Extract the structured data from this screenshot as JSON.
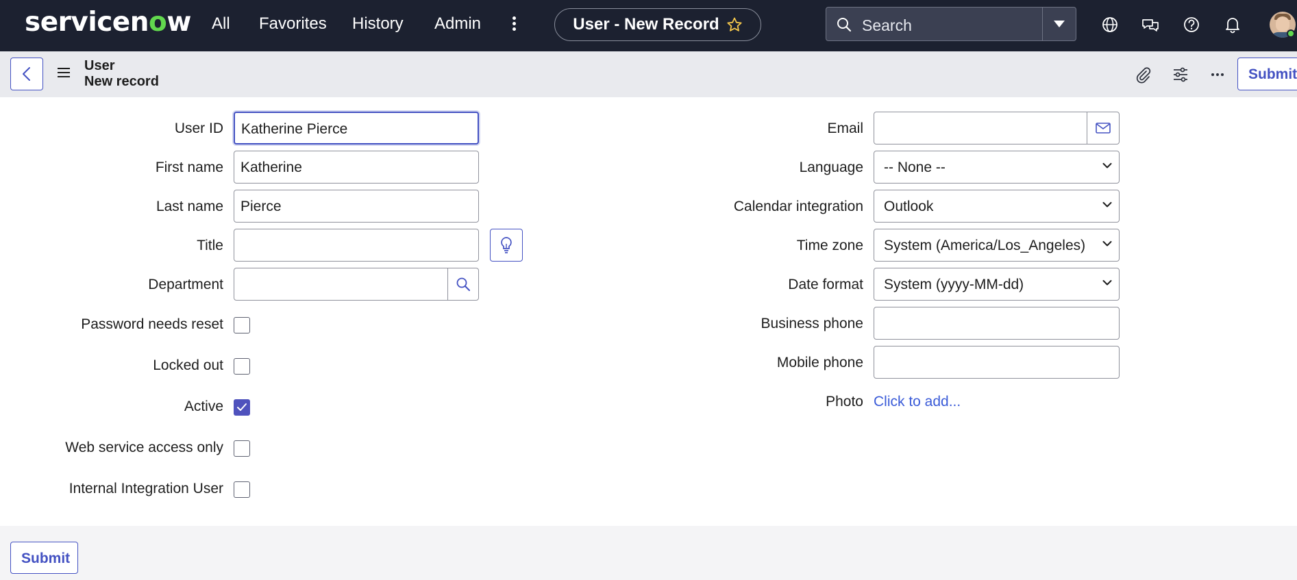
{
  "topnav": {
    "logo_text_a": "servicen",
    "logo_text_o": "o",
    "logo_text_b": "w",
    "links": [
      "All",
      "Favorites",
      "History",
      "Admin"
    ],
    "record_title": "User - New Record",
    "search_placeholder": "Search"
  },
  "header": {
    "table_name": "User",
    "record_state": "New record",
    "submit_label": "Submit"
  },
  "form": {
    "left": {
      "user_id": {
        "label": "User ID",
        "value": "Katherine Pierce"
      },
      "first_name": {
        "label": "First name",
        "value": "Katherine"
      },
      "last_name": {
        "label": "Last name",
        "value": "Pierce"
      },
      "title": {
        "label": "Title",
        "value": ""
      },
      "department": {
        "label": "Department",
        "value": ""
      },
      "password_needs_reset": {
        "label": "Password needs reset",
        "checked": false
      },
      "locked_out": {
        "label": "Locked out",
        "checked": false
      },
      "active": {
        "label": "Active",
        "checked": true
      },
      "web_service_access_only": {
        "label": "Web service access only",
        "checked": false
      },
      "internal_integration_user": {
        "label": "Internal Integration User",
        "checked": false
      }
    },
    "right": {
      "email": {
        "label": "Email",
        "value": ""
      },
      "language": {
        "label": "Language",
        "value": "-- None --"
      },
      "calendar_integration": {
        "label": "Calendar integration",
        "value": "Outlook"
      },
      "time_zone": {
        "label": "Time zone",
        "value": "System (America/Los_Angeles)"
      },
      "date_format": {
        "label": "Date format",
        "value": "System (yyyy-MM-dd)"
      },
      "business_phone": {
        "label": "Business phone",
        "value": ""
      },
      "mobile_phone": {
        "label": "Mobile phone",
        "value": ""
      },
      "photo": {
        "label": "Photo",
        "link": "Click to add..."
      }
    }
  },
  "footer": {
    "submit_label": "Submit"
  },
  "colors": {
    "nav_bg": "#1c2130",
    "accent": "#4351c2",
    "logo_green": "#62d84e",
    "subheader_bg": "#e9eaee",
    "link": "#3a5bd8"
  }
}
